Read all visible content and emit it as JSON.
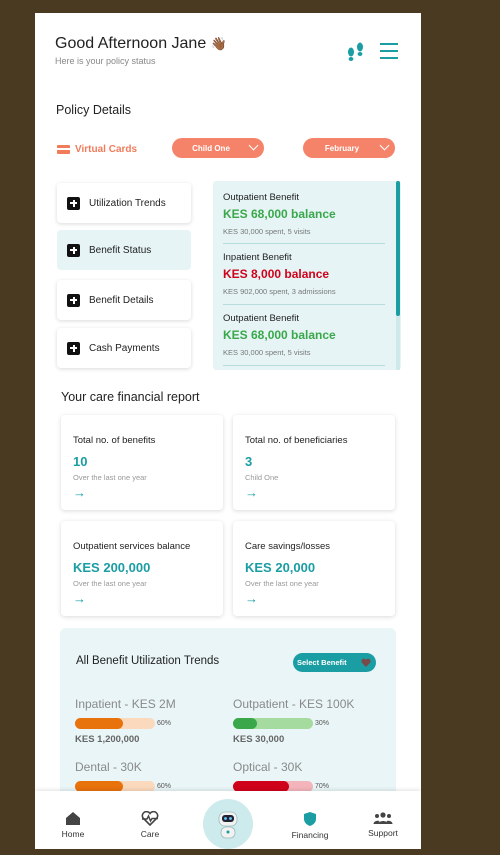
{
  "header": {
    "greeting": "Good Afternoon Jane",
    "wave_emoji": "👋🏾",
    "subtitle": "Here is your policy status",
    "icons": [
      "footsteps-icon",
      "hamburger-menu-icon"
    ]
  },
  "policy": {
    "title": "Policy Details",
    "virtual_cards_label": "Virtual Cards",
    "member_select": "Child One",
    "month_select": "February"
  },
  "side_menu": [
    {
      "label": "Utilization Trends"
    },
    {
      "label": "Benefit Status"
    },
    {
      "label": "Benefit Details"
    },
    {
      "label": "Cash Payments"
    }
  ],
  "benefits": [
    {
      "name": "Outpatient Benefit",
      "balance": "KES 68,000 balance",
      "detail": "KES 30,000 spent, 5 visits",
      "color": "#3aa84a"
    },
    {
      "name": "Inpatient Benefit",
      "balance": "KES 8,000 balance",
      "detail": "KES 902,000 spent, 3 admissions",
      "color": "#d0021b"
    },
    {
      "name": "Outpatient Benefit",
      "balance": "KES 68,000 balance",
      "detail": "KES 30,000 spent, 5 visits",
      "color": "#3aa84a"
    }
  ],
  "report": {
    "title": "Your care financial report",
    "cards": [
      {
        "title": "Total no. of benefits",
        "value": "10",
        "sub": "Over the last one year"
      },
      {
        "title": "Total no. of beneficiaries",
        "value": "3",
        "sub": "Child One"
      },
      {
        "title": "Outpatient services balance",
        "value": "KES 200,000",
        "sub": "Over the last one year"
      },
      {
        "title": "Care savings/losses",
        "value": "KES 20,000",
        "sub": "Over the last one year"
      }
    ]
  },
  "trends": {
    "title": "All Benefit Utilization Trends",
    "select_label": "Select Benefit",
    "items": [
      {
        "label": "Inpatient - KES 2M",
        "percent": 60,
        "percent_label": "60%",
        "amount": "KES 1,200,000",
        "fill": "#e8720c",
        "track": "#fbd9bd"
      },
      {
        "label": "Outpatient - KES 100K",
        "percent": 30,
        "percent_label": "30%",
        "amount": "KES 30,000",
        "fill": "#3aa84a",
        "track": "#a6dba0"
      },
      {
        "label": "Dental - 30K",
        "percent": 60,
        "percent_label": "60%",
        "amount": "",
        "fill": "#e8720c",
        "track": "#fbd9bd"
      },
      {
        "label": "Optical - 30K",
        "percent": 70,
        "percent_label": "70%",
        "amount": "",
        "fill": "#d0021b",
        "track": "#f4b4bb"
      }
    ]
  },
  "nav": [
    {
      "label": "Home",
      "icon": "home-icon"
    },
    {
      "label": "Care",
      "icon": "heartbeat-icon"
    },
    {
      "label": "",
      "icon": "robot-assistant-icon"
    },
    {
      "label": "Financing",
      "icon": "shield-icon"
    },
    {
      "label": "Support",
      "icon": "people-icon"
    }
  ],
  "colors": {
    "accent": "#1a9da3",
    "coral": "#f5836a"
  }
}
